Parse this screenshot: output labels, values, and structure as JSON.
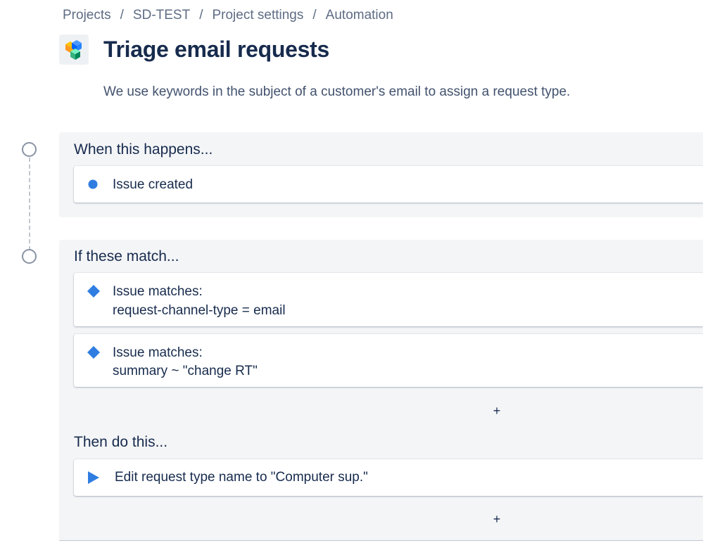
{
  "breadcrumb": {
    "items": [
      "Projects",
      "SD-TEST",
      "Project settings",
      "Automation"
    ],
    "separator": "/"
  },
  "header": {
    "logo_icon": "cube-logo-icon",
    "title": "Triage email requests",
    "description": "We use keywords in the subject of a customer's email to assign a request type."
  },
  "trigger_section": {
    "title": "When this happens...",
    "items": [
      {
        "icon": "dot-icon",
        "label": "Issue created"
      }
    ]
  },
  "condition_section": {
    "title": "If these match...",
    "items": [
      {
        "icon": "diamond-icon",
        "label": "Issue matches:",
        "detail": "request-channel-type = email"
      },
      {
        "icon": "diamond-icon",
        "label": "Issue matches:",
        "detail": "summary ~ \"change RT\""
      }
    ],
    "add_label": "+"
  },
  "action_section": {
    "title": "Then do this...",
    "items": [
      {
        "icon": "play-icon",
        "label": "Edit request type name to \"Computer sup.\""
      }
    ],
    "add_label": "+"
  },
  "colors": {
    "accent": "#2f7de1",
    "section_bg": "#f4f5f7",
    "text_primary": "#172b4d",
    "text_secondary": "#5e6c84",
    "timeline": "#8993a4"
  }
}
